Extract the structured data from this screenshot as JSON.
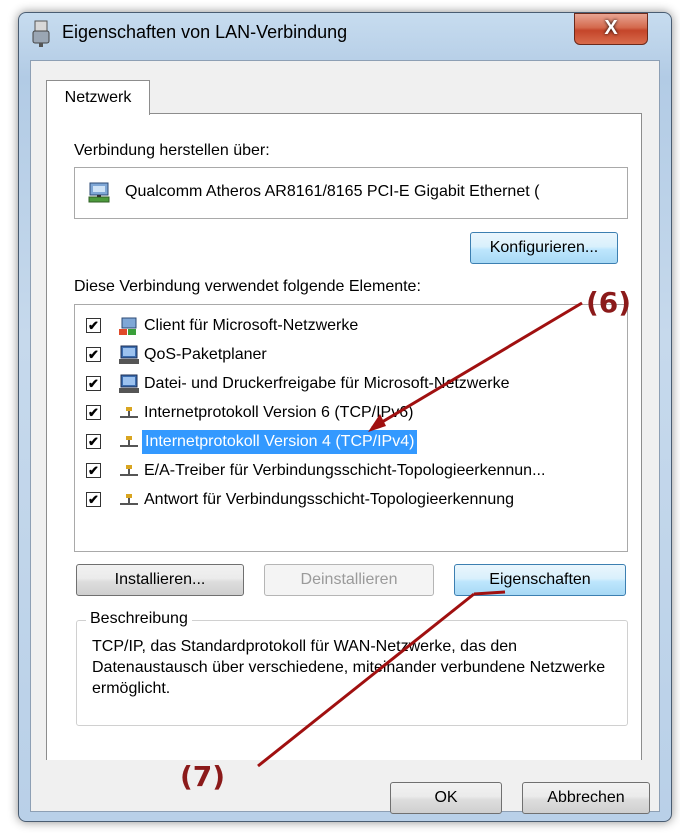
{
  "window": {
    "title": "Eigenschaften von LAN-Verbindung",
    "close_label": "X"
  },
  "tabs": [
    {
      "label": "Netzwerk",
      "active": true
    }
  ],
  "connection": {
    "label": "Verbindung herstellen über:",
    "adapter": "Qualcomm Atheros AR8161/8165 PCI-E Gigabit Ethernet (",
    "configure_label": "Konfigurieren..."
  },
  "elements": {
    "label": "Diese Verbindung verwendet folgende Elemente:",
    "items": [
      {
        "label": "Client für Microsoft-Netzwerke",
        "checked": true,
        "icon": "network-client-icon",
        "selected": false
      },
      {
        "label": "QoS-Paketplaner",
        "checked": true,
        "icon": "network-service-icon",
        "selected": false
      },
      {
        "label": "Datei- und Druckerfreigabe für Microsoft-Netzwerke",
        "checked": true,
        "icon": "network-service-icon",
        "selected": false
      },
      {
        "label": "Internetprotokoll Version 6 (TCP/IPv6)",
        "checked": true,
        "icon": "protocol-icon",
        "selected": false
      },
      {
        "label": "Internetprotokoll Version 4 (TCP/IPv4)",
        "checked": true,
        "icon": "protocol-icon",
        "selected": true
      },
      {
        "label": "E/A-Treiber für Verbindungsschicht-Topologieerkennun...",
        "checked": true,
        "icon": "protocol-icon",
        "selected": false
      },
      {
        "label": "Antwort für Verbindungsschicht-Topologieerkennung",
        "checked": true,
        "icon": "protocol-icon",
        "selected": false
      }
    ]
  },
  "actions": {
    "install": "Installieren...",
    "uninstall": "Deinstallieren",
    "properties": "Eigenschaften"
  },
  "description": {
    "legend": "Beschreibung",
    "text": "TCP/IP, das Standardprotokoll für WAN-Netzwerke, das den Datenaustausch über verschiedene, miteinander verbundene Netzwerke ermöglicht."
  },
  "footer": {
    "ok": "OK",
    "cancel": "Abbrechen"
  },
  "annotations": {
    "step6": "(6)",
    "step7": "(7)"
  },
  "colors": {
    "selection": "#3399ff",
    "annotation": "#8b1a1a",
    "close_button": "#c4452a"
  }
}
